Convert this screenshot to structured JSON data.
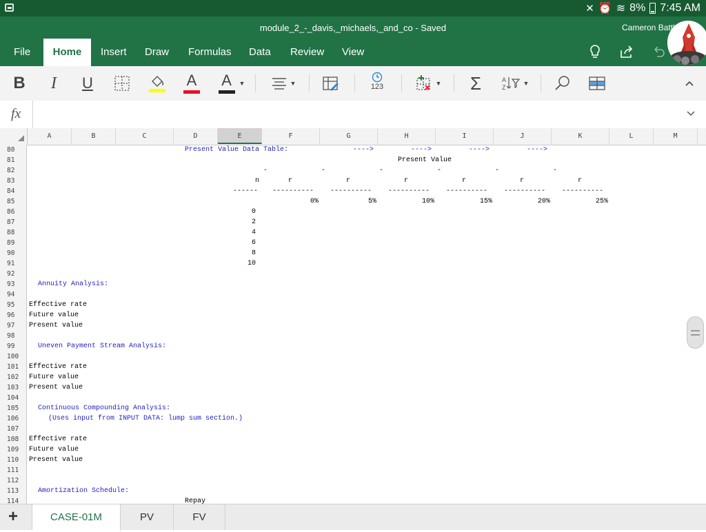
{
  "status": {
    "battery": "8%",
    "time": "7:45 AM"
  },
  "title": {
    "document": "module_2_-_davis,_michaels,_and_co - Saved",
    "user": "Cameron Battl"
  },
  "tabs": [
    "File",
    "Home",
    "Insert",
    "Draw",
    "Formulas",
    "Data",
    "Review",
    "View"
  ],
  "toolbar": {
    "bold": "B",
    "italic": "I",
    "underline": "U",
    "font_color": "A",
    "font_color2": "A",
    "sum": "Σ",
    "number_format": "123"
  },
  "formula_bar": {
    "fx": "fx",
    "value": ""
  },
  "columns": [
    "A",
    "B",
    "C",
    "D",
    "E",
    "F",
    "G",
    "H",
    "I",
    "J",
    "K",
    "L",
    "M"
  ],
  "rows": [
    "80",
    "81",
    "82",
    "83",
    "84",
    "85",
    "86",
    "87",
    "88",
    "89",
    "90",
    "91",
    "92",
    "93",
    "94",
    "95",
    "96",
    "97",
    "98",
    "99",
    "100",
    "101",
    "102",
    "103",
    "104",
    "105",
    "106",
    "107",
    "108",
    "109",
    "110",
    "111",
    "112",
    "113",
    "114"
  ],
  "cells": {
    "r80_pv_table": "Present Value Data Table:",
    "r80_arrow1": "---->",
    "r80_arrow2": "---->",
    "r80_arrow3": "---->",
    "r80_arrow4": "---->",
    "r81_present_value": "Present Value",
    "r82_dash": "-",
    "r83_n": "n",
    "r83_r": "r",
    "r84_n_dash": "------",
    "r84_r_dash": "----------",
    "r85": [
      "0%",
      "5%",
      "10%",
      "15%",
      "20%",
      "25%"
    ],
    "n_values": [
      "0",
      "2",
      "4",
      "6",
      "8",
      "10"
    ],
    "annuity": "Annuity Analysis:",
    "effective_rate": "Effective rate",
    "future_value": "Future value",
    "present_value": "Present value",
    "uneven": "Uneven Payment Stream Analysis:",
    "continuous": "Continuous Compounding Analysis:",
    "continuous_note": "(Uses input from INPUT DATA: lump sum section.)",
    "amortization": "Amortization Schedule:",
    "repay": "Repay"
  },
  "sheets": [
    "CASE-01M",
    "PV",
    "FV"
  ],
  "colors": {
    "excel_green": "#217346",
    "status_green": "#175a32",
    "label_blue": "#1f1fbf"
  }
}
